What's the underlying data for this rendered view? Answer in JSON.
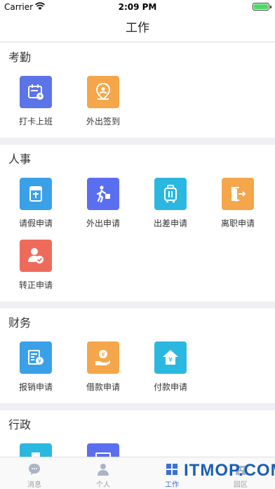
{
  "status": {
    "carrier": "Carrier",
    "time": "2:09 PM"
  },
  "nav": {
    "title": "工作"
  },
  "sections": [
    {
      "title": "考勤",
      "items": [
        {
          "label": "打卡上班",
          "icon": "calendar-clock-icon",
          "color": "#5b74e8"
        },
        {
          "label": "外出签到",
          "icon": "location-pin-icon",
          "color": "#f5a64a"
        }
      ]
    },
    {
      "title": "人事",
      "items": [
        {
          "label": "请假申请",
          "icon": "leave-calendar-icon",
          "color": "#3aa0e8"
        },
        {
          "label": "外出申请",
          "icon": "walking-person-icon",
          "color": "#5a6ff0"
        },
        {
          "label": "出差申请",
          "icon": "suitcase-icon",
          "color": "#2bb8e0"
        },
        {
          "label": "离职申请",
          "icon": "exit-door-icon",
          "color": "#f5a64a"
        },
        {
          "label": "转正申请",
          "icon": "user-check-icon",
          "color": "#ee6b5c"
        }
      ]
    },
    {
      "title": "财务",
      "items": [
        {
          "label": "报销申请",
          "icon": "reimburse-doc-icon",
          "color": "#3aa0e8"
        },
        {
          "label": "借款申请",
          "icon": "yen-hand-icon",
          "color": "#f5a64a"
        },
        {
          "label": "付款申请",
          "icon": "yen-house-icon",
          "color": "#2bb8e0"
        }
      ]
    },
    {
      "title": "行政",
      "items": [
        {
          "label": "",
          "icon": "printer-icon",
          "color": "#2bb8e0"
        },
        {
          "label": "",
          "icon": "monitor-icon",
          "color": "#5a6ff0"
        }
      ]
    }
  ],
  "tabbar": {
    "tabs": [
      {
        "label": "消息",
        "icon": "chat-bubble-icon"
      },
      {
        "label": "个人",
        "icon": "person-icon"
      },
      {
        "label": "工作",
        "icon": "grid-icon",
        "active": true
      },
      {
        "label": "园区",
        "icon": "campus-icon"
      }
    ]
  },
  "watermark": {
    "text": "ITMOP.COM"
  }
}
